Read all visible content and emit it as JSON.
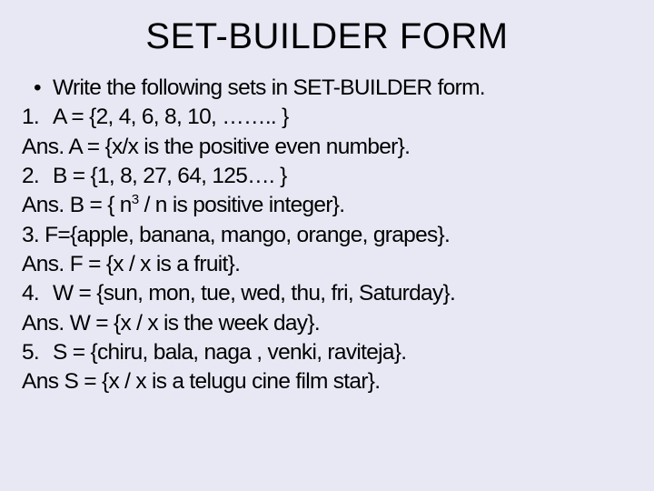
{
  "title": "SET-BUILDER FORM",
  "intro_bullet": "•",
  "intro_text": "Write the following sets in SET-BUILDER form.",
  "rows": {
    "q1_label": "1.",
    "q1_text": "A = {2, 4, 6, 8, 10, …….. }",
    "a1_label": "Ans.",
    "a1_text": "A = {x/x is the positive even number}.",
    "q2_label": "2.",
    "q2_text": "B = {1, 8, 27, 64, 125…. }",
    "a2_label": "Ans.",
    "a2_pre": "B = { n",
    "a2_sup": "3",
    "a2_post": " / n is positive integer}.",
    "q3_text": "3. F={apple, banana, mango, orange, grapes}.",
    "a3_label": "Ans.",
    "a3_text": "F = {x / x is a fruit}.",
    "q4_label": "4.",
    "q4_text": "W = {sun, mon, tue, wed, thu, fri, Saturday}.",
    "a4_label": "Ans.",
    "a4_text": " W = {x / x is the week day}.",
    "q5_label": "5.",
    "q5_text": "S = {chiru, bala, naga , venki, raviteja}.",
    "a5_label": "Ans",
    "a5_text": "  S = {x / x is a telugu cine film star}."
  }
}
